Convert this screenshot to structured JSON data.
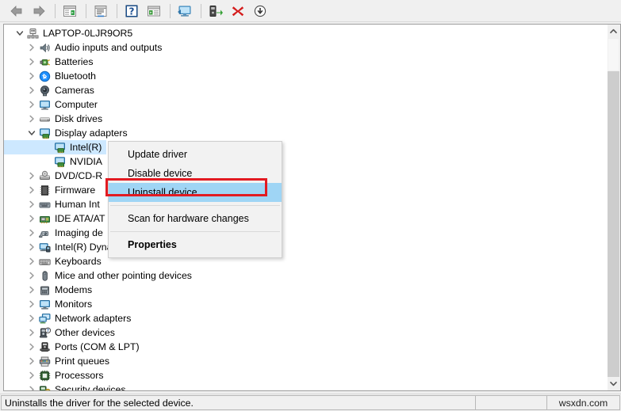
{
  "toolbar": {
    "buttons": [
      {
        "name": "back-button",
        "icon": "back-arrow-icon",
        "title": "Back"
      },
      {
        "name": "forward-button",
        "icon": "forward-arrow-icon",
        "title": "Forward"
      },
      {
        "name": "show-hide-console-tree-button",
        "icon": "console-tree-icon",
        "title": "Show/Hide Console Tree"
      },
      {
        "name": "properties-button",
        "icon": "properties-icon",
        "title": "Properties"
      },
      {
        "name": "help-button",
        "icon": "help-question-icon",
        "title": "Help"
      },
      {
        "name": "view-button",
        "icon": "view-list-icon",
        "title": "View"
      },
      {
        "name": "scan-hardware-changes-button",
        "icon": "scan-monitor-icon",
        "title": "Scan for hardware changes"
      },
      {
        "name": "update-driver-button",
        "icon": "update-driver-icon",
        "title": "Update driver"
      },
      {
        "name": "uninstall-device-button",
        "icon": "red-x-icon",
        "title": "Uninstall device"
      },
      {
        "name": "disable-device-button",
        "icon": "down-arrow-circle-icon",
        "title": "Disable device"
      }
    ]
  },
  "tree": {
    "root": {
      "label": "LAPTOP-0LJR9OR5",
      "icon": "computer-node-icon",
      "expanded": true
    },
    "items": [
      {
        "label": "Audio inputs and outputs",
        "icon": "speaker-icon",
        "depth": 1,
        "expanded": false,
        "selected": false
      },
      {
        "label": "Batteries",
        "icon": "battery-icon",
        "depth": 1,
        "expanded": false,
        "selected": false
      },
      {
        "label": "Bluetooth",
        "icon": "bluetooth-icon",
        "depth": 1,
        "expanded": false,
        "selected": false
      },
      {
        "label": "Cameras",
        "icon": "camera-icon",
        "depth": 1,
        "expanded": false,
        "selected": false
      },
      {
        "label": "Computer",
        "icon": "monitor-icon",
        "depth": 1,
        "expanded": false,
        "selected": false
      },
      {
        "label": "Disk drives",
        "icon": "disk-drive-icon",
        "depth": 1,
        "expanded": false,
        "selected": false
      },
      {
        "label": "Display adapters",
        "icon": "display-adapter-icon",
        "depth": 1,
        "expanded": true,
        "selected": false
      },
      {
        "label": "Intel(R)",
        "icon": "display-adapter-icon",
        "depth": 2,
        "expanded": null,
        "selected": true
      },
      {
        "label": "NVIDIA",
        "icon": "display-adapter-icon",
        "depth": 2,
        "expanded": null,
        "selected": false
      },
      {
        "label": "DVD/CD-R",
        "icon": "dvd-drive-icon",
        "depth": 1,
        "expanded": false,
        "selected": false
      },
      {
        "label": "Firmware",
        "icon": "firmware-chip-icon",
        "depth": 1,
        "expanded": false,
        "selected": false
      },
      {
        "label": "Human Int",
        "icon": "hid-keyboard-icon",
        "depth": 1,
        "expanded": false,
        "selected": false
      },
      {
        "label": "IDE ATA/AT",
        "icon": "ide-controller-icon",
        "depth": 1,
        "expanded": false,
        "selected": false
      },
      {
        "label": "Imaging de",
        "icon": "imaging-device-icon",
        "depth": 1,
        "expanded": false,
        "selected": false
      },
      {
        "label": "Intel(R) Dynamic Platform and Thermal Framework",
        "icon": "system-device-icon",
        "depth": 1,
        "expanded": false,
        "selected": false
      },
      {
        "label": "Keyboards",
        "icon": "keyboard-icon",
        "depth": 1,
        "expanded": false,
        "selected": false
      },
      {
        "label": "Mice and other pointing devices",
        "icon": "mouse-icon",
        "depth": 1,
        "expanded": false,
        "selected": false
      },
      {
        "label": "Modems",
        "icon": "modem-icon",
        "depth": 1,
        "expanded": false,
        "selected": false
      },
      {
        "label": "Monitors",
        "icon": "monitor-icon",
        "depth": 1,
        "expanded": false,
        "selected": false
      },
      {
        "label": "Network adapters",
        "icon": "network-adapter-icon",
        "depth": 1,
        "expanded": false,
        "selected": false
      },
      {
        "label": "Other devices",
        "icon": "other-device-icon",
        "depth": 1,
        "expanded": false,
        "selected": false
      },
      {
        "label": "Ports (COM & LPT)",
        "icon": "port-icon",
        "depth": 1,
        "expanded": false,
        "selected": false
      },
      {
        "label": "Print queues",
        "icon": "printer-icon",
        "depth": 1,
        "expanded": false,
        "selected": false
      },
      {
        "label": "Processors",
        "icon": "processor-icon",
        "depth": 1,
        "expanded": false,
        "selected": false
      },
      {
        "label": "Security devices",
        "icon": "security-device-icon",
        "depth": 1,
        "expanded": false,
        "selected": false
      }
    ]
  },
  "context_menu": {
    "items": [
      {
        "label": "Update driver",
        "highlighted": false,
        "bold": false
      },
      {
        "label": "Disable device",
        "highlighted": false,
        "bold": false
      },
      {
        "label": "Uninstall device",
        "highlighted": true,
        "bold": false
      },
      {
        "separator": true
      },
      {
        "label": "Scan for hardware changes",
        "highlighted": false,
        "bold": false
      },
      {
        "separator": true
      },
      {
        "label": "Properties",
        "highlighted": false,
        "bold": true
      }
    ],
    "highlight_color": "#9fd5f5",
    "annotation_box_color": "#e21b22"
  },
  "statusbar": {
    "text": "Uninstalls the driver for the selected device.",
    "watermark": "wsxdn.com"
  },
  "colors": {
    "selection": "#cde8ff",
    "menu_highlight": "#9fd5f5",
    "annotation_red": "#e21b22",
    "chrome": "#f0f0f0"
  }
}
